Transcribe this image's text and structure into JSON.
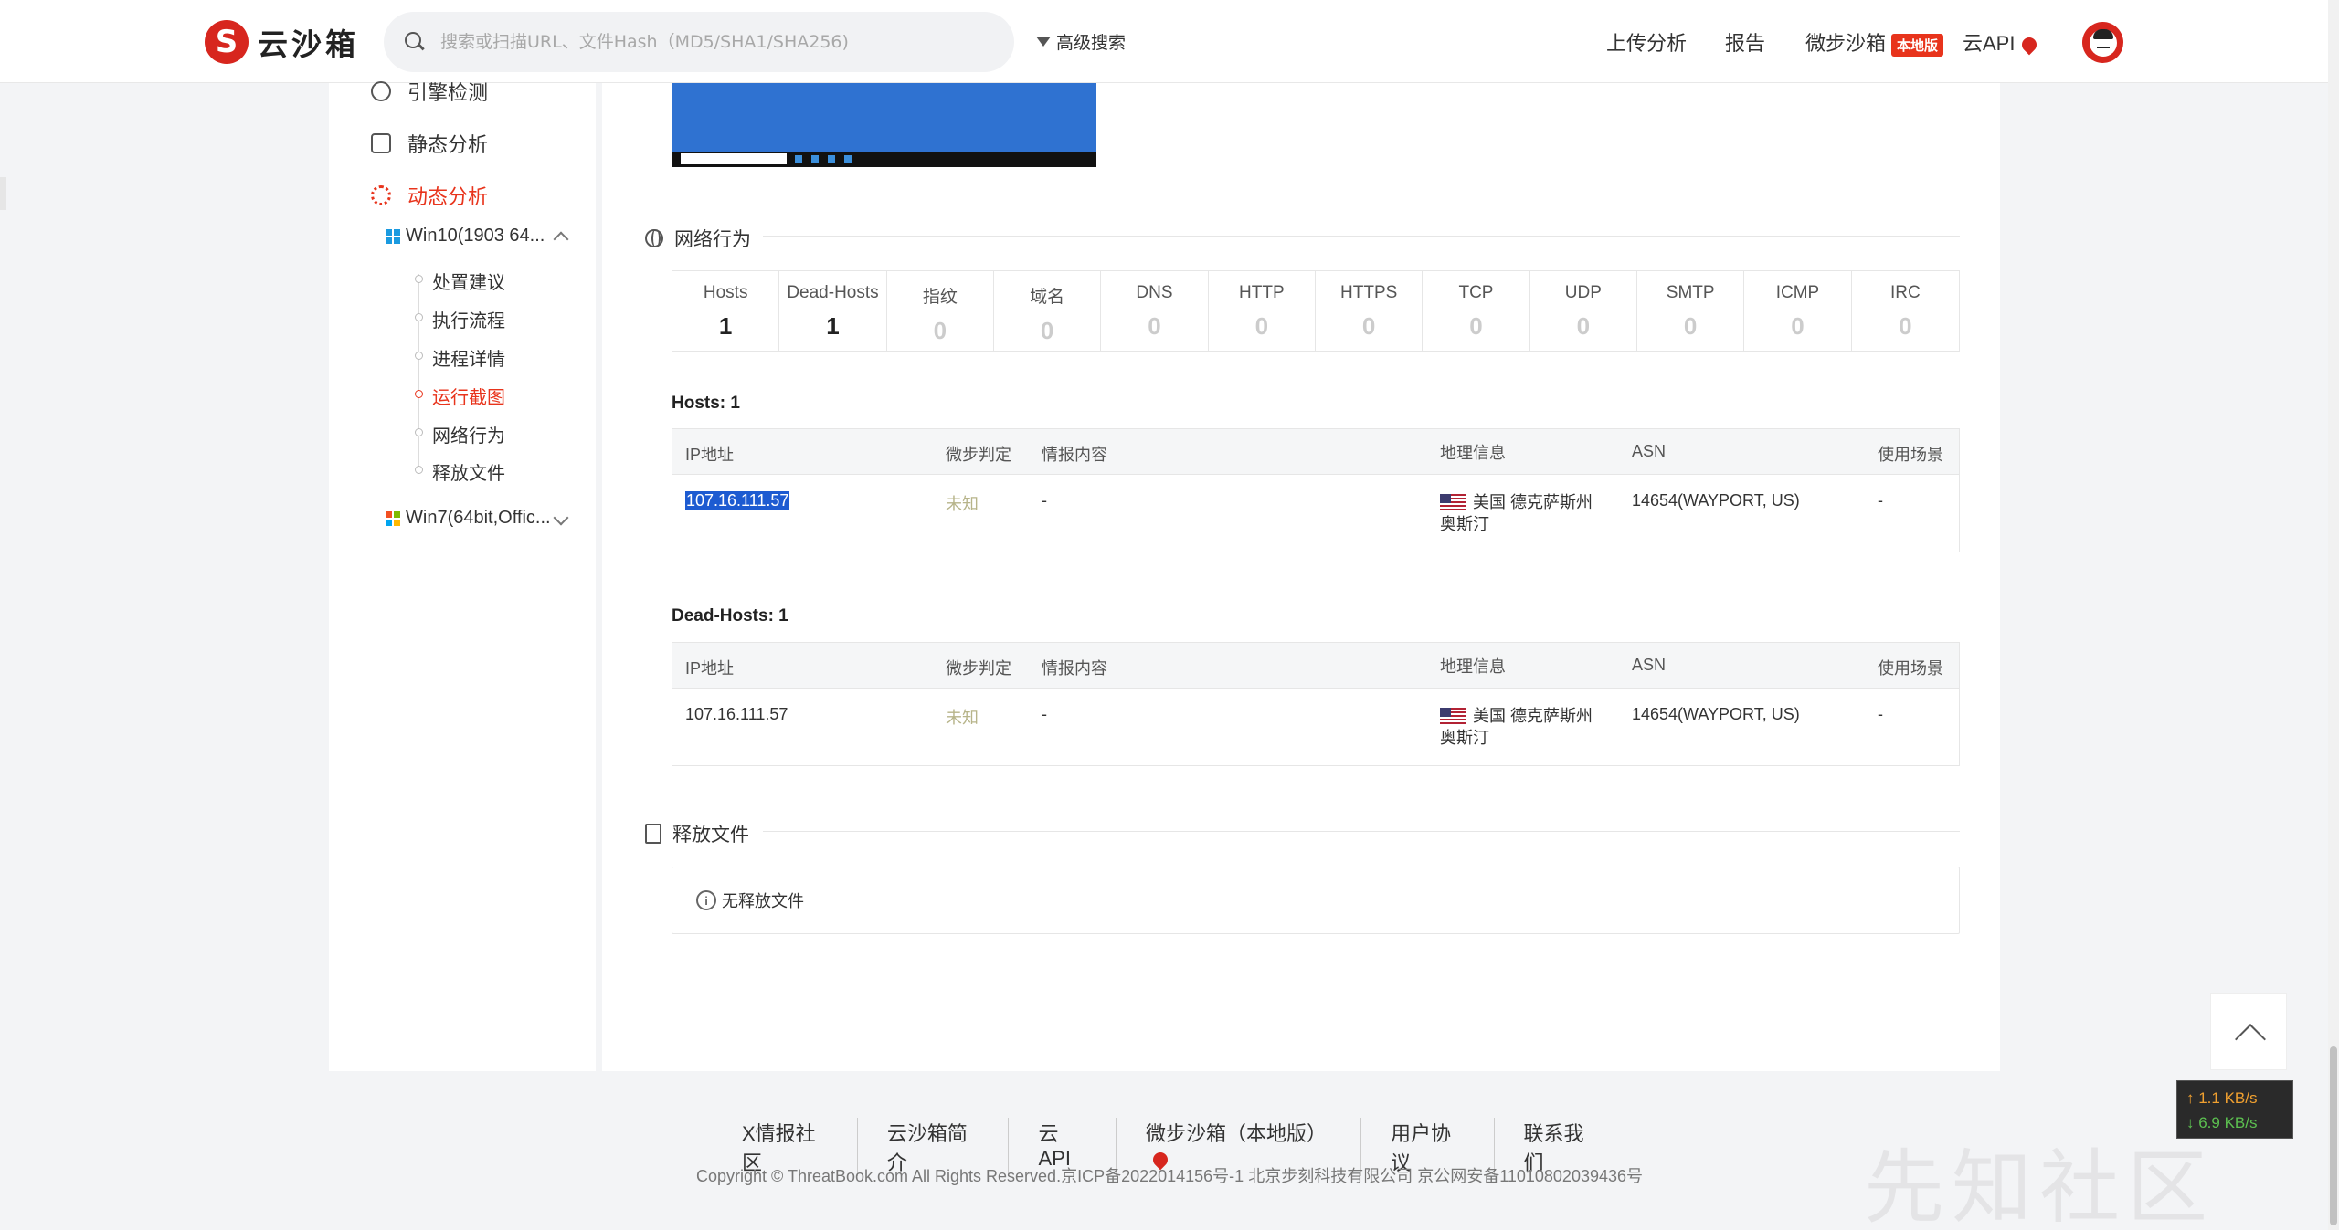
{
  "header": {
    "logo_mark": "S",
    "logo_text": "云沙箱",
    "search_placeholder": "搜索或扫描URL、文件Hash（MD5/SHA1/SHA256)",
    "advanced_search": "高级搜索",
    "nav": {
      "upload": "上传分析",
      "report": "报告",
      "local_sandbox": "微步沙箱",
      "local_badge": "本地版",
      "cloud_api": "云API"
    }
  },
  "sidebar": {
    "engine": "引擎检测",
    "static": "静态分析",
    "dynamic": "动态分析",
    "env_win10": "Win10(1903 64...",
    "env_win7": "Win7(64bit,Offic...",
    "tree": [
      "处置建议",
      "执行流程",
      "进程详情",
      "运行截图",
      "网络行为",
      "释放文件"
    ]
  },
  "network": {
    "title": "网络行为",
    "stats": [
      {
        "label": "Hosts",
        "value": "1"
      },
      {
        "label": "Dead-Hosts",
        "value": "1"
      },
      {
        "label": "指纹",
        "value": "0"
      },
      {
        "label": "域名",
        "value": "0"
      },
      {
        "label": "DNS",
        "value": "0"
      },
      {
        "label": "HTTP",
        "value": "0"
      },
      {
        "label": "HTTPS",
        "value": "0"
      },
      {
        "label": "TCP",
        "value": "0"
      },
      {
        "label": "UDP",
        "value": "0"
      },
      {
        "label": "SMTP",
        "value": "0"
      },
      {
        "label": "ICMP",
        "value": "0"
      },
      {
        "label": "IRC",
        "value": "0"
      }
    ],
    "hosts_label": "Hosts:  1",
    "dead_hosts_label": "Dead-Hosts:  1",
    "columns": [
      "IP地址",
      "微步判定",
      "情报内容",
      "地理信息",
      "ASN",
      "使用场景"
    ],
    "hosts_row": {
      "ip": "107.16.111.57",
      "verdict": "未知",
      "intel": "-",
      "geo": "美国 德克萨斯州 奥斯汀",
      "asn": "14654(WAYPORT, US)",
      "scene": "-"
    },
    "dead_row": {
      "ip": "107.16.111.57",
      "verdict": "未知",
      "intel": "-",
      "geo": "美国 德克萨斯州 奥斯汀",
      "asn": "14654(WAYPORT, US)",
      "scene": "-"
    }
  },
  "released": {
    "title": "释放文件",
    "empty": "无释放文件"
  },
  "footer": {
    "links": [
      "X情报社区",
      "云沙箱简介",
      "云API",
      "微步沙箱（本地版）",
      "用户协议",
      "联系我们"
    ],
    "copyright": "Copyright © ThreatBook.com All Rights Reserved.京ICP备2022014156号-1 北京步刻科技有限公司 京公网安备11010802039436号"
  },
  "speed": {
    "up": "↑ 1.1 KB/s",
    "down": "↓ 6.9 KB/s"
  },
  "watermark": "先知社区",
  "colors": {
    "brand": "#d7261e",
    "accent": "#e8341c",
    "selection": "#1d5bd1"
  }
}
